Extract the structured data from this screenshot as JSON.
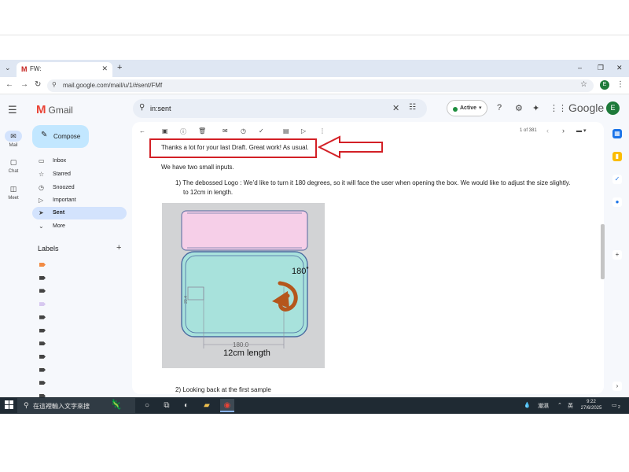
{
  "browser": {
    "tab_title": "FW:",
    "new_tab": "+",
    "url": "mail.google.com/mail/u/1/#sent/FMf",
    "profile_initial": "E",
    "window_controls": {
      "minimize": "–",
      "restore": "❐",
      "close": "✕"
    }
  },
  "gmail": {
    "brand": "Gmail",
    "search_value": "in:sent",
    "status": "Active",
    "google": "Google",
    "avatar": "E",
    "compose": "Compose",
    "rail": [
      {
        "label": "Mail",
        "icon": "mail-icon"
      },
      {
        "label": "Chat",
        "icon": "chat-icon"
      },
      {
        "label": "Meet",
        "icon": "meet-icon"
      }
    ],
    "nav": [
      {
        "label": "Inbox",
        "icon": "inbox-icon",
        "glyph": "▭"
      },
      {
        "label": "Starred",
        "icon": "star-icon",
        "glyph": "☆"
      },
      {
        "label": "Snoozed",
        "icon": "clock-icon",
        "glyph": "◷"
      },
      {
        "label": "Important",
        "icon": "important-icon",
        "glyph": "▷"
      },
      {
        "label": "Sent",
        "icon": "send-icon",
        "glyph": "➤"
      },
      {
        "label": "More",
        "icon": "chevron-down-icon",
        "glyph": "⌄"
      }
    ],
    "labels_title": "Labels",
    "label_colors": [
      "#f28b44",
      "#444444",
      "#444444",
      "#d7c8f0",
      "#444444",
      "#444444",
      "#444444",
      "#444444",
      "#444444",
      "#444444",
      "#444444"
    ],
    "pager": "1 of 381"
  },
  "email": {
    "line1": "Thanks a lot for your last Draft. Great work! As usual.",
    "line2": "We have two small inputs.",
    "line3a": "1) The debossed Logo : We’d like to turn it 180 degrees, so it will face the user when opening the box. We would like to adjust the size slightly.",
    "line3b": "to 12cm in length.",
    "figure": {
      "angle_label": "180˚",
      "dim_label": "180.0",
      "length_label": "12cm length",
      "side_dim": "23.4"
    },
    "line4": "2) Looking back at the first sample"
  },
  "taskbar": {
    "search_placeholder": "在這裡輸入文字來搜",
    "weather": "潮濕",
    "ime": "英",
    "time": "9:22",
    "date": "27/6/2025",
    "notifications": "2"
  },
  "colors": {
    "highlight_red": "#d32026",
    "box_top": "#f6cfe8",
    "box_body": "#a8e2dc",
    "arrow_brown": "#b5561c"
  }
}
